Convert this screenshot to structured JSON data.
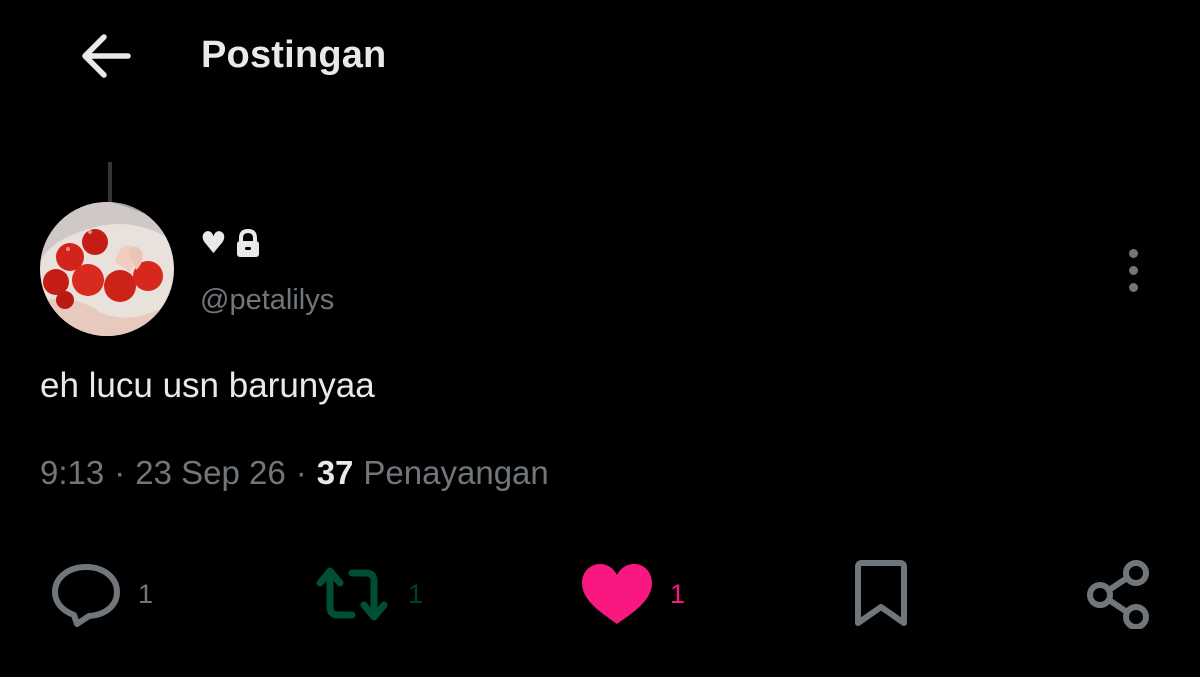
{
  "header": {
    "back_icon": "arrow-left-icon",
    "title": "Postingan"
  },
  "post": {
    "author": {
      "display_name_text": "♥",
      "display_name_icon": "lock-icon",
      "handle": "@petalilys",
      "avatar": "tomatoes-photo"
    },
    "text": "eh lucu usn barunya",
    "text_suffix": "a",
    "time": "9:13",
    "date": "23 Sep 26",
    "views_count": "37",
    "views_label": "Penayangan"
  },
  "actions": {
    "reply_count": "1",
    "retweet_count": "1",
    "like_count": "1",
    "colors": {
      "muted": "#71767b",
      "retweet": "#00ba7c",
      "like": "#f91880"
    }
  }
}
